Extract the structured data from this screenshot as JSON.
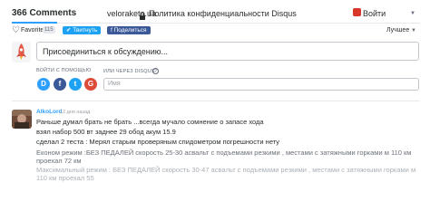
{
  "topbar": {
    "comment_count": "366 Comments",
    "site_name": "veloraketa.ua",
    "privacy_label": "Политика конфиденциальности Disqus",
    "login_label": "Войти"
  },
  "actions": {
    "favorite_label": "Favorite",
    "favorite_count": "115",
    "tweet_label": "Твитнуть",
    "share_label": "Поделиться",
    "sort_label": "Лучшее"
  },
  "composer": {
    "placeholder": "Присоединиться к обсуждению...",
    "login_with_label": "ВОЙТИ С ПОМОЩЬЮ",
    "or_disqus_label": "ИЛИ ЧЕРЕЗ DISQUS",
    "help_symbol": "?",
    "name_placeholder": "Имя",
    "social": [
      {
        "letter": "D",
        "color": "#2e9fff"
      },
      {
        "letter": "f",
        "color": "#3b5998"
      },
      {
        "letter": "t",
        "color": "#1da1f2"
      },
      {
        "letter": "G",
        "color": "#dd4b39"
      }
    ]
  },
  "comment": {
    "author": "AlkoLord",
    "time": "12 дня назад",
    "lines": [
      "Раньше думал брать не брать ...всегда мучало сомнение о запасе хода",
      "взял набор 500 вт заднее 29 обод акум 15.9",
      "сделал 2 теста : Мерял старым проверяным спидометром погрешности нету",
      "Економ режим :БЕЗ ПЕДАЛЕЙ скорость 25-30 асвальт с подъемами резкими , местами с затяжными горками м 110 км проехал 72 км",
      "Максимальный режим : БЕЗ ПЕДАЛЕЙ скорость 30-47 асвальт с подъемами резкими , местами с затяжными горками м 110 км проехал 55"
    ]
  },
  "colors": {
    "accent": "#2e9fff",
    "notification": "#d9362a",
    "text": "#2a2e2e",
    "muted": "#656c7a"
  }
}
